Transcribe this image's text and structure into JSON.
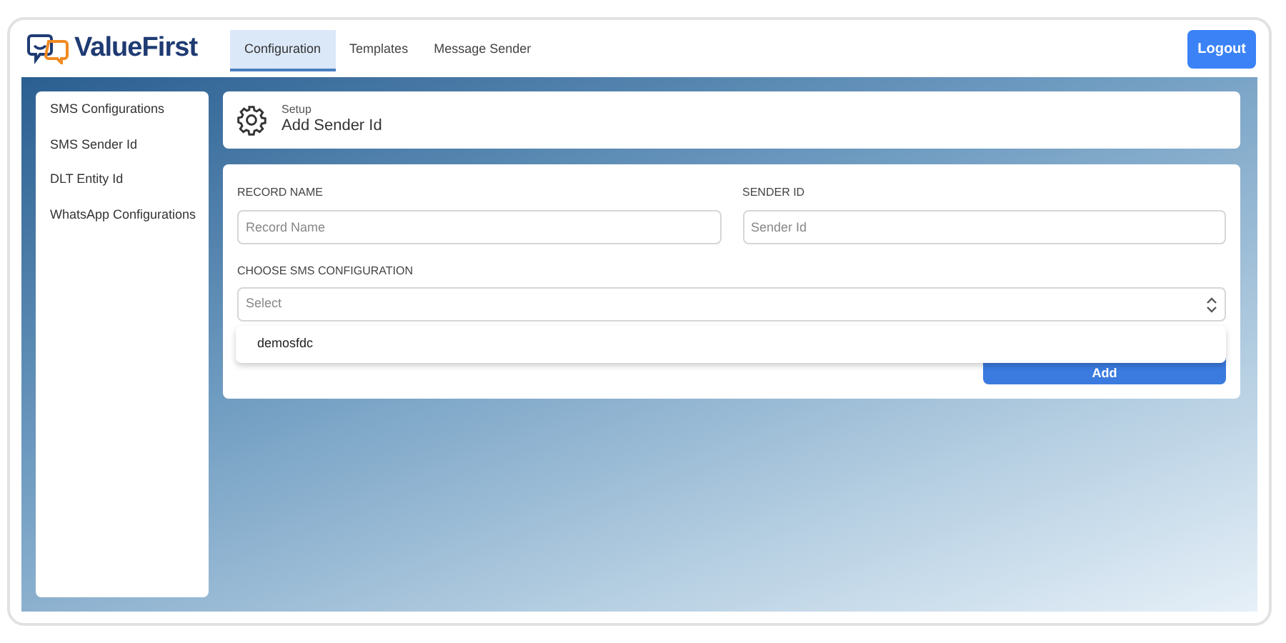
{
  "brand": "ValueFirst",
  "tabs": [
    {
      "label": "Configuration",
      "selected": true
    },
    {
      "label": "Templates",
      "selected": false
    },
    {
      "label": "Message Sender",
      "selected": false
    }
  ],
  "logout": "Logout",
  "sidebar": {
    "items": [
      {
        "label": "SMS Configurations"
      },
      {
        "label": "SMS Sender Id"
      },
      {
        "label": "DLT Entity Id"
      },
      {
        "label": "WhatsApp Configurations"
      }
    ]
  },
  "header_card": {
    "eyebrow": "Setup",
    "title": "Add Sender Id"
  },
  "form": {
    "fields": [
      {
        "label": "RECORD NAME",
        "placeholder": "Record Name"
      },
      {
        "label": "SENDER ID",
        "placeholder": "Sender Id"
      }
    ],
    "select": {
      "label": "CHOOSE SMS CONFIGURATION",
      "placeholder": "Select",
      "expanded": true,
      "options": [
        "demosfdc"
      ]
    },
    "submit": "Add"
  }
}
